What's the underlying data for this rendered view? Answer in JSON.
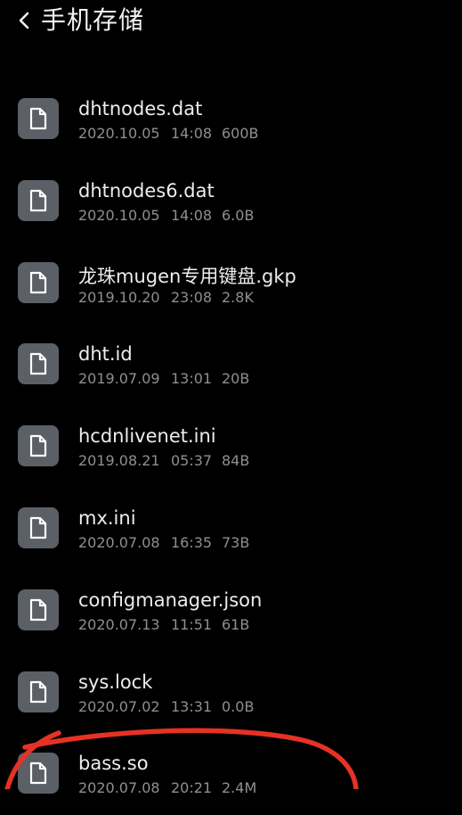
{
  "header": {
    "title": "手机存储"
  },
  "files": [
    {
      "name": "dhtnodes.dat",
      "date": "2020.10.05",
      "time": "14:08",
      "size": "600B"
    },
    {
      "name": "dhtnodes6.dat",
      "date": "2020.10.05",
      "time": "14:08",
      "size": "6.0B"
    },
    {
      "name": "龙珠mugen专用键盘.gkp",
      "date": "2019.10.20",
      "time": "23:08",
      "size": "2.8K"
    },
    {
      "name": "dht.id",
      "date": "2019.07.09",
      "time": "13:01",
      "size": "20B"
    },
    {
      "name": "hcdnlivenet.ini",
      "date": "2019.08.21",
      "time": "05:37",
      "size": "84B"
    },
    {
      "name": "mx.ini",
      "date": "2020.07.08",
      "time": "16:35",
      "size": "73B"
    },
    {
      "name": "configmanager.json",
      "date": "2020.07.13",
      "time": "11:51",
      "size": "61B"
    },
    {
      "name": "sys.lock",
      "date": "2020.07.02",
      "time": "13:31",
      "size": "0.0B"
    },
    {
      "name": "bass.so",
      "date": "2020.07.08",
      "time": "20:21",
      "size": "2.4M"
    }
  ],
  "annotation_color": "#e53224"
}
